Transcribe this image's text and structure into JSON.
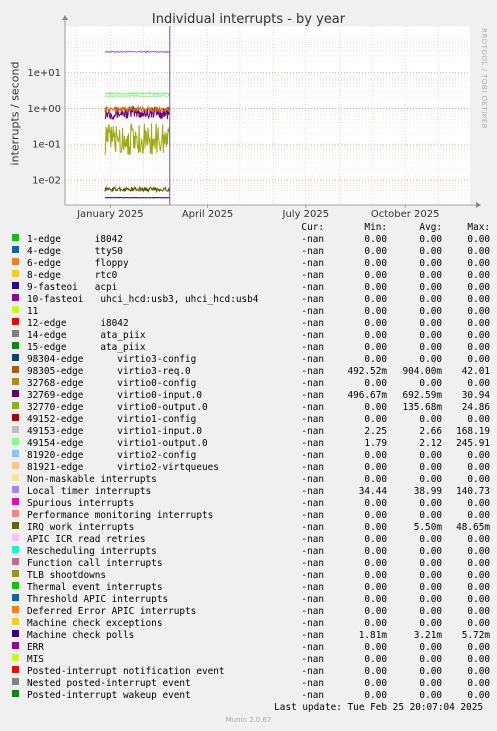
{
  "chart_data": {
    "type": "line",
    "title": "Individual interrupts - by year",
    "ylabel": "interrupts / second",
    "y_scale": "log",
    "ylim": [
      0.002,
      200
    ],
    "y_ticks": [
      "1e+01",
      "1e+00",
      "1e-01",
      "1e-02"
    ],
    "x_ticks": [
      "January 2025",
      "April 2025",
      "July 2025",
      "October 2025"
    ],
    "grid": true,
    "watermark": "RRDTOOL / TOBI OETIKER",
    "data_region": "late Dec 2024 to late Feb 2025",
    "traces": [
      {
        "label": "Local timer interrupts",
        "color": "#9a6fd8",
        "level": 38,
        "noise": 0.04
      },
      {
        "label": "virtio0-input.0",
        "color": "#6a0080",
        "level": 0.75,
        "noise": 0.35
      },
      {
        "label": "virtio3-req.0",
        "color": "#cc6a00",
        "level": 0.95,
        "noise": 0.15
      },
      {
        "label": "virtio1-input.0",
        "color": "#7ef27e",
        "level": 2.6,
        "noise": 0.05
      },
      {
        "label": "virtio1-output.0",
        "color": "#9ff29f",
        "level": 2.2,
        "noise": 0.05
      },
      {
        "label": "virtio0-output.0",
        "color": "#9aaa10",
        "level": 0.14,
        "noise": 0.9
      },
      {
        "label": "IRQ work interrupts",
        "color": "#5a5a00",
        "level": 0.0055,
        "noise": 0.12
      },
      {
        "label": "Machine check polls",
        "color": "#2a0090",
        "level": 0.0032,
        "noise": 0.01
      }
    ],
    "legend_header": {
      "cur": "Cur:",
      "min": "Min:",
      "avg": "Avg:",
      "max": "Max:"
    },
    "rows": [
      {
        "label": "1-edge      i8042",
        "color": "#00cc00",
        "cur": "-nan",
        "min": "0.00",
        "avg": "0.00",
        "max": "0.00"
      },
      {
        "label": "4-edge      ttyS0",
        "color": "#0066b3",
        "cur": "-nan",
        "min": "0.00",
        "avg": "0.00",
        "max": "0.00"
      },
      {
        "label": "6-edge      floppy",
        "color": "#ff8000",
        "cur": "-nan",
        "min": "0.00",
        "avg": "0.00",
        "max": "0.00"
      },
      {
        "label": "8-edge      rtc0",
        "color": "#ffcc00",
        "cur": "-nan",
        "min": "0.00",
        "avg": "0.00",
        "max": "0.00"
      },
      {
        "label": "9-fasteoi   acpi",
        "color": "#330099",
        "cur": "-nan",
        "min": "0.00",
        "avg": "0.00",
        "max": "0.00"
      },
      {
        "label": "10-fasteoi   uhci_hcd:usb3, uhci_hcd:usb4",
        "color": "#990099",
        "cur": "-nan",
        "min": "0.00",
        "avg": "0.00",
        "max": "0.00"
      },
      {
        "label": "11",
        "color": "#ccff00",
        "cur": "-nan",
        "min": "0.00",
        "avg": "0.00",
        "max": "0.00"
      },
      {
        "label": "12-edge      i8042",
        "color": "#ff0000",
        "cur": "-nan",
        "min": "0.00",
        "avg": "0.00",
        "max": "0.00"
      },
      {
        "label": "14-edge      ata_piix",
        "color": "#808080",
        "cur": "-nan",
        "min": "0.00",
        "avg": "0.00",
        "max": "0.00"
      },
      {
        "label": "15-edge      ata_piix",
        "color": "#008f00",
        "cur": "-nan",
        "min": "0.00",
        "avg": "0.00",
        "max": "0.00"
      },
      {
        "label": "98304-edge      virtio3-config",
        "color": "#00487d",
        "cur": "-nan",
        "min": "0.00",
        "avg": "0.00",
        "max": "0.00"
      },
      {
        "label": "98305-edge      virtio3-req.0",
        "color": "#b35a00",
        "cur": "-nan",
        "min": "492.52m",
        "avg": "904.00m",
        "max": "42.01"
      },
      {
        "label": "32768-edge      virtio0-config",
        "color": "#b38f00",
        "cur": "-nan",
        "min": "0.00",
        "avg": "0.00",
        "max": "0.00"
      },
      {
        "label": "32769-edge      virtio0-input.0",
        "color": "#6b006b",
        "cur": "-nan",
        "min": "496.67m",
        "avg": "692.59m",
        "max": "30.94"
      },
      {
        "label": "32770-edge      virtio0-output.0",
        "color": "#8fb300",
        "cur": "-nan",
        "min": "0.00",
        "avg": "135.68m",
        "max": "24.86"
      },
      {
        "label": "49152-edge      virtio1-config",
        "color": "#b30000",
        "cur": "-nan",
        "min": "0.00",
        "avg": "0.00",
        "max": "0.00"
      },
      {
        "label": "49153-edge      virtio1-input.0",
        "color": "#bebebe",
        "cur": "-nan",
        "min": "2.25",
        "avg": "2.66",
        "max": "168.19"
      },
      {
        "label": "49154-edge      virtio1-output.0",
        "color": "#80ff80",
        "cur": "-nan",
        "min": "1.79",
        "avg": "2.12",
        "max": "245.91"
      },
      {
        "label": "81920-edge      virtio2-config",
        "color": "#80c9ff",
        "cur": "-nan",
        "min": "0.00",
        "avg": "0.00",
        "max": "0.00"
      },
      {
        "label": "81921-edge      virtio2-virtqueues",
        "color": "#ffc080",
        "cur": "-nan",
        "min": "0.00",
        "avg": "0.00",
        "max": "0.00"
      },
      {
        "label": "Non-maskable interrupts",
        "color": "#ffe680",
        "cur": "-nan",
        "min": "0.00",
        "avg": "0.00",
        "max": "0.00"
      },
      {
        "label": "Local timer interrupts",
        "color": "#aa80ff",
        "cur": "-nan",
        "min": "34.44",
        "avg": "38.99",
        "max": "140.73"
      },
      {
        "label": "Spurious interrupts",
        "color": "#ee00cc",
        "cur": "-nan",
        "min": "0.00",
        "avg": "0.00",
        "max": "0.00"
      },
      {
        "label": "Performance monitoring interrupts",
        "color": "#ff8080",
        "cur": "-nan",
        "min": "0.00",
        "avg": "0.00",
        "max": "0.00"
      },
      {
        "label": "IRQ work interrupts",
        "color": "#666600",
        "cur": "-nan",
        "min": "0.00",
        "avg": "5.50m",
        "max": "48.65m"
      },
      {
        "label": "APIC ICR read retries",
        "color": "#ffbfff",
        "cur": "-nan",
        "min": "0.00",
        "avg": "0.00",
        "max": "0.00"
      },
      {
        "label": "Rescheduling interrupts",
        "color": "#00ffcc",
        "cur": "-nan",
        "min": "0.00",
        "avg": "0.00",
        "max": "0.00"
      },
      {
        "label": "Function call interrupts",
        "color": "#cc6699",
        "cur": "-nan",
        "min": "0.00",
        "avg": "0.00",
        "max": "0.00"
      },
      {
        "label": "TLB shootdowns",
        "color": "#999900",
        "cur": "-nan",
        "min": "0.00",
        "avg": "0.00",
        "max": "0.00"
      },
      {
        "label": "Thermal event interrupts",
        "color": "#00cc00",
        "cur": "-nan",
        "min": "0.00",
        "avg": "0.00",
        "max": "0.00"
      },
      {
        "label": "Threshold APIC interrupts",
        "color": "#0066b3",
        "cur": "-nan",
        "min": "0.00",
        "avg": "0.00",
        "max": "0.00"
      },
      {
        "label": "Deferred Error APIC interrupts",
        "color": "#ff8000",
        "cur": "-nan",
        "min": "0.00",
        "avg": "0.00",
        "max": "0.00"
      },
      {
        "label": "Machine check exceptions",
        "color": "#ffcc00",
        "cur": "-nan",
        "min": "0.00",
        "avg": "0.00",
        "max": "0.00"
      },
      {
        "label": "Machine check polls",
        "color": "#330099",
        "cur": "-nan",
        "min": "1.81m",
        "avg": "3.21m",
        "max": "5.72m"
      },
      {
        "label": "ERR",
        "color": "#990099",
        "cur": "-nan",
        "min": "0.00",
        "avg": "0.00",
        "max": "0.00"
      },
      {
        "label": "MIS",
        "color": "#ccff00",
        "cur": "-nan",
        "min": "0.00",
        "avg": "0.00",
        "max": "0.00"
      },
      {
        "label": "Posted-interrupt notification event",
        "color": "#ff0000",
        "cur": "-nan",
        "min": "0.00",
        "avg": "0.00",
        "max": "0.00"
      },
      {
        "label": "Nested posted-interrupt event",
        "color": "#808080",
        "cur": "-nan",
        "min": "0.00",
        "avg": "0.00",
        "max": "0.00"
      },
      {
        "label": "Posted-interrupt wakeup event",
        "color": "#008f00",
        "cur": "-nan",
        "min": "0.00",
        "avg": "0.00",
        "max": "0.00"
      }
    ]
  },
  "footer": {
    "last_update": "Last update: Tue Feb 25 20:07:04 2025",
    "munin": "Munin 2.0.67"
  }
}
